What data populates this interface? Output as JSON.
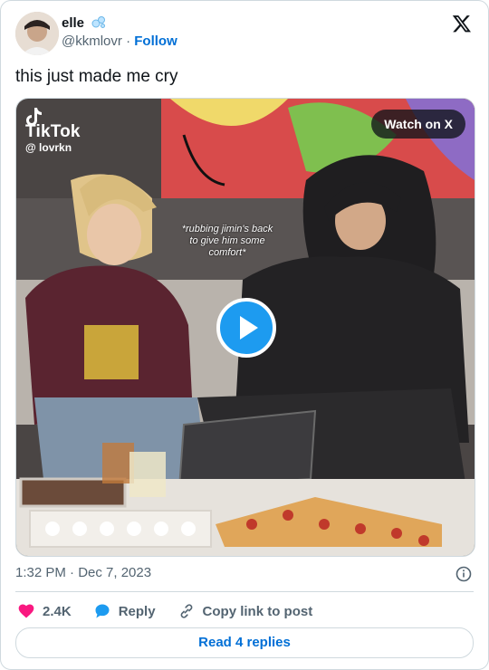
{
  "author": {
    "display_name": "elle",
    "badge_icon": "bubbles-emoji-icon",
    "handle": "@kkmlovr",
    "separator": "·",
    "follow_label": "Follow"
  },
  "tweet": {
    "text": "this just made me cry",
    "timestamp": "1:32 PM · Dec 7, 2023"
  },
  "media": {
    "watch_label": "Watch on X",
    "watermark_brand": "TikTok",
    "watermark_user": "@ lovrkn",
    "caption_lines": [
      "*rubbing jimin's back",
      "to give him some",
      "comfort*"
    ]
  },
  "actions": {
    "like_count": "2.4K",
    "reply_label": "Reply",
    "copy_label": "Copy link to post",
    "read_replies_label": "Read 4 replies"
  },
  "colors": {
    "like": "#f91880",
    "link": "#006fd6",
    "play": "#1d9bf0",
    "muted": "#536471"
  }
}
